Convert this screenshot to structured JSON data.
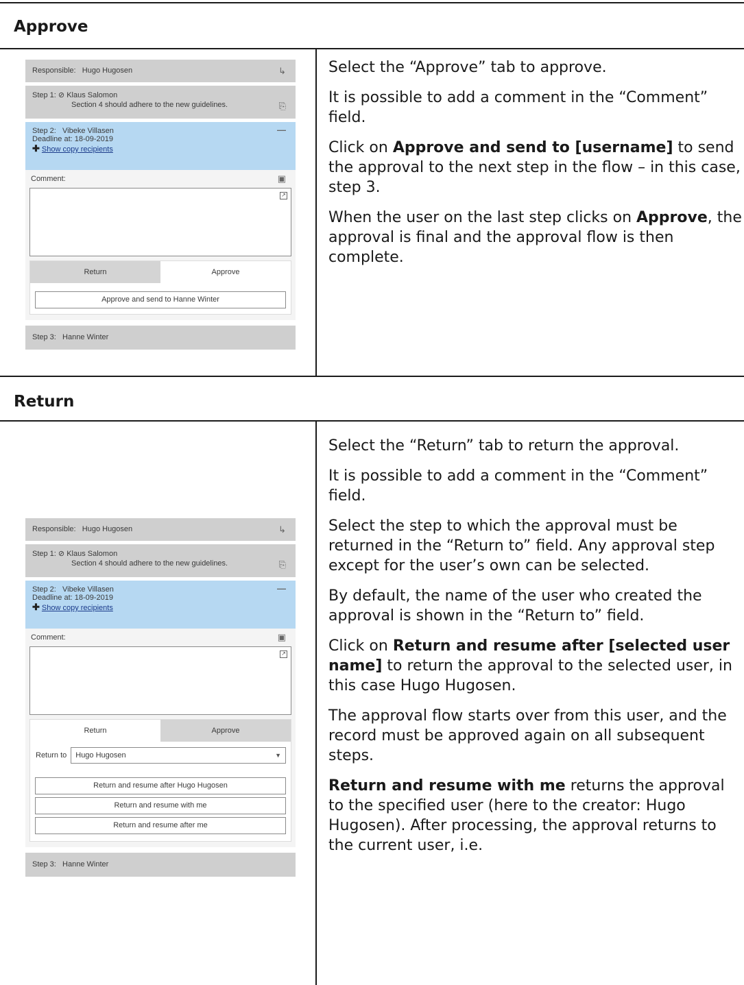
{
  "approve_section": {
    "title": "Approve",
    "panel": {
      "responsible_label": "Responsible:",
      "responsible_name": "Hugo Hugosen",
      "step1_label": "Step 1:",
      "step1_name": "Klaus Salomon",
      "step1_comment": "Section 4 should adhere to the new guidelines.",
      "step2_label": "Step 2:",
      "step2_name": "Vibeke Villasen",
      "deadline": "Deadline at: 18-09-2019",
      "show_copy": "Show copy recipients",
      "comment_label": "Comment:",
      "tab_return": "Return",
      "tab_approve": "Approve",
      "approve_button": "Approve and send to Hanne Winter",
      "step3_label": "Step 3:",
      "step3_name": "Hanne Winter"
    },
    "p1": "Select the “Approve” tab to approve.",
    "p2": "It is possible to add a comment in the “Comment” field.",
    "p3_prefix": "Click on ",
    "p3_bold": "Approve and send to [username]",
    "p3_suffix": " to send the approval to the next step in the flow – in this case, step 3.",
    "p4_prefix": "When the user on the last step clicks on ",
    "p4_bold": "Approve",
    "p4_suffix": ", the approval is final and the approval flow is then complete."
  },
  "return_section": {
    "title": "Return",
    "panel": {
      "responsible_label": "Responsible:",
      "responsible_name": "Hugo Hugosen",
      "step1_label": "Step 1:",
      "step1_name": "Klaus Salomon",
      "step1_comment": "Section 4 should adhere to the new guidelines.",
      "step2_label": "Step 2:",
      "step2_name": "Vibeke Villasen",
      "deadline": "Deadline at: 18-09-2019",
      "show_copy": "Show copy recipients",
      "comment_label": "Comment:",
      "tab_return": "Return",
      "tab_approve": "Approve",
      "return_to_label": "Return to",
      "return_to_value": "Hugo Hugosen",
      "btn_resume_after_user": "Return and resume after Hugo Hugosen",
      "btn_resume_with_me": "Return and resume with me",
      "btn_resume_after_me": "Return and resume after me",
      "step3_label": "Step 3:",
      "step3_name": "Hanne Winter"
    },
    "p1": "Select the “Return” tab to return the approval.",
    "p2": "It is possible to add a comment in the “Comment” field.",
    "p3": "Select the step to which the approval must be returned in the “Return to” field. Any approval step except for the user’s own can be selected.",
    "p4": "By default, the name of the user who created the approval is shown in the “Return to” field.",
    "p5_prefix": "Click on ",
    "p5_bold": "Return and resume after [selected user name]",
    "p5_suffix": " to return the approval to the selected user, in this case Hugo Hugosen.",
    "p6": "The approval flow starts over from this user, and the record must be approved again on all subsequent steps.",
    "p7_bold": "Return and resume with me",
    "p7_suffix": " returns the approval to the specified user (here to the creator: Hugo Hugosen). After processing, the approval returns to the current user, i.e."
  }
}
